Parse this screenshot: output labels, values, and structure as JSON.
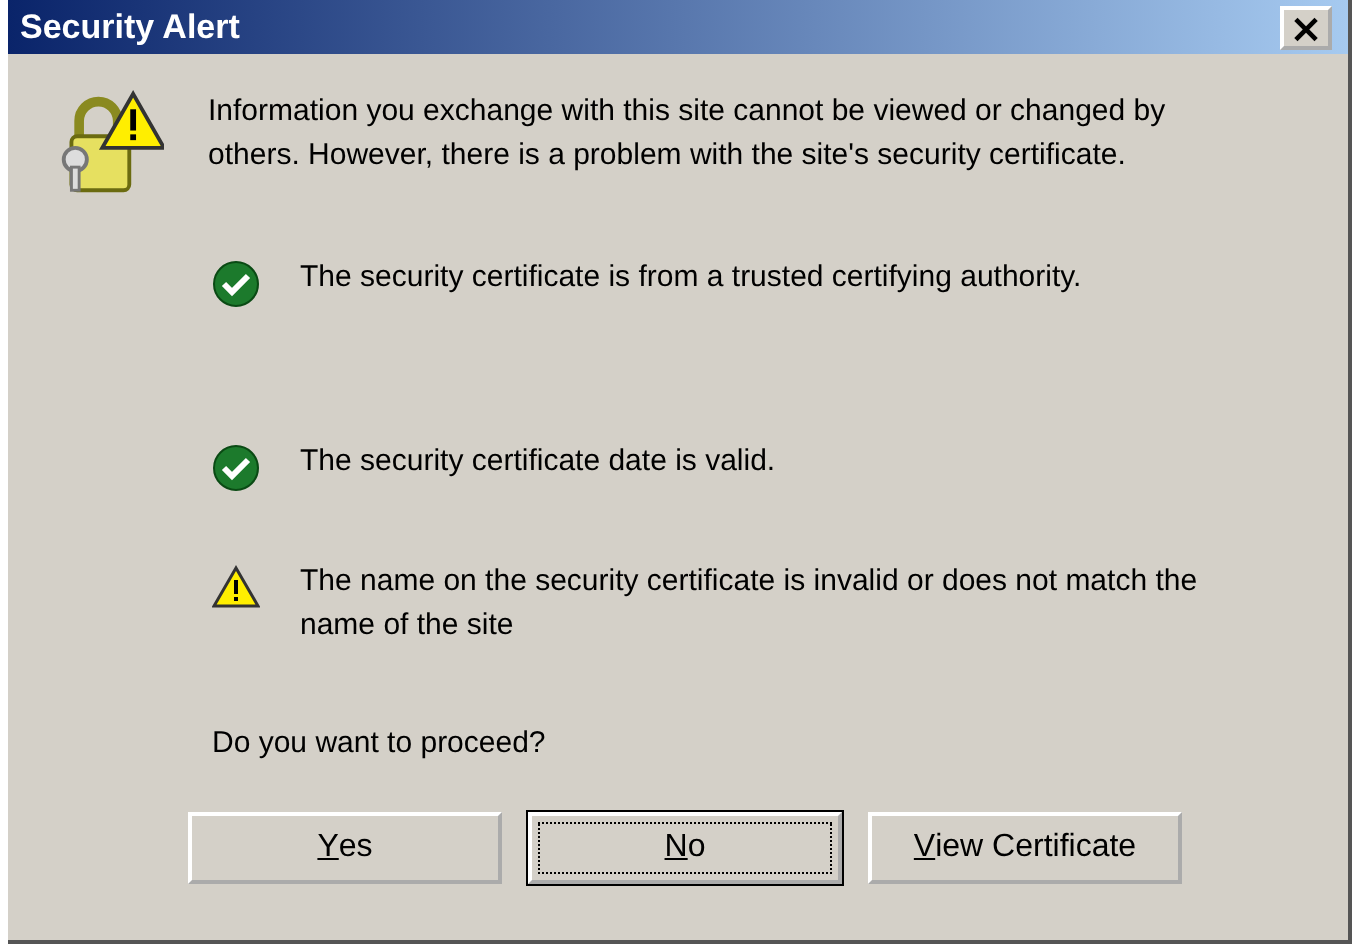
{
  "window": {
    "title": "Security Alert",
    "close": "×"
  },
  "message": "Information you exchange with this site cannot be viewed or changed by others. However, there is a problem with the site's security certificate.",
  "checks": [
    {
      "kind": "ok",
      "text": "The security certificate is from a trusted certifying authority."
    },
    {
      "kind": "ok",
      "text": "The security certificate date is valid."
    },
    {
      "kind": "warning",
      "text": "The name on the security certificate is invalid or does not match the name of the site"
    }
  ],
  "question": "Do you want to proceed?",
  "buttons": [
    {
      "label": "Yes",
      "mnemonic": true,
      "default": false
    },
    {
      "label": "No",
      "mnemonic": true,
      "default": true
    },
    {
      "label": "View Certificate",
      "mnemonic": true,
      "default": false
    }
  ]
}
